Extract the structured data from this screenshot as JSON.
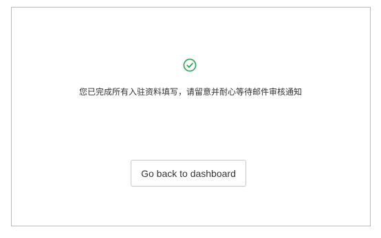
{
  "status": {
    "icon": "check-circle-icon",
    "color": "#2fa84f"
  },
  "message": "您已完成所有入驻资料填写，请留意并耐心等待邮件审核通知",
  "actions": {
    "back_label": "Go back to dashboard"
  }
}
